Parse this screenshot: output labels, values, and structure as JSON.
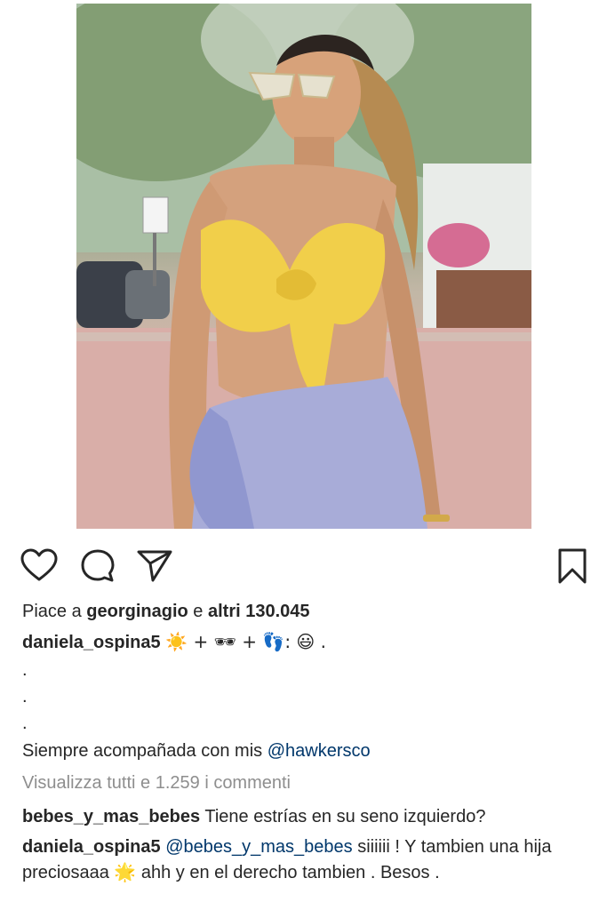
{
  "post": {
    "likes_prefix": "Piace a",
    "liked_by_user": "georginagio",
    "likes_join": "e",
    "likes_others": "altri 130.045",
    "caption_user": "daniela_ospina5",
    "caption_emoji": "☀️ + 🕶 + 👣: 😃 .",
    "caption_dots": [
      ".",
      ".",
      "."
    ],
    "caption_text": "Siempre acompañada con mis",
    "caption_mention": "@hawkersco",
    "view_all_comments": "Visualizza tutti e 1.259 i commenti"
  },
  "comments": [
    {
      "user": "bebes_y_mas_bebes",
      "text": "Tiene estrías en su seno izquierdo?"
    },
    {
      "user": "daniela_ospina5",
      "mention": "@bebes_y_mas_bebes",
      "text_1": "siiiiii ! Y tambien una hija preciosaaa",
      "emoji": "🌟",
      "text_2": "ahh y en el derecho tambien . Besos ."
    }
  ],
  "icons": {
    "like": "heart-icon",
    "comment": "comment-icon",
    "share": "share-icon",
    "save": "bookmark-icon"
  },
  "colors": {
    "text": "#262626",
    "muted": "#8e8e8e",
    "link": "#00376b",
    "top_yellow": "#f1cf4a",
    "skirt_lavender": "#a8acd8"
  }
}
